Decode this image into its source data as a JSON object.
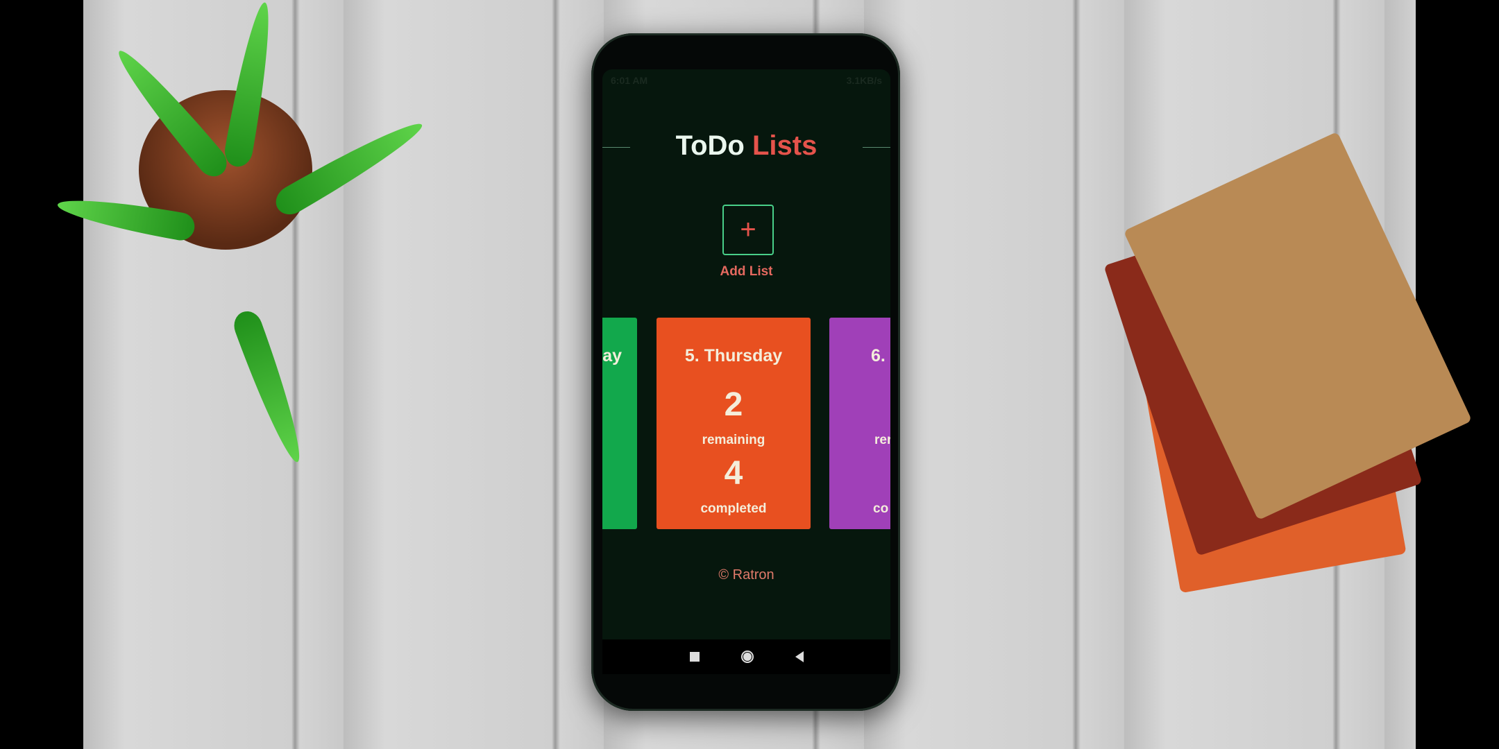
{
  "status_bar": {
    "time": "6:01 AM",
    "net_speed": "3.1KB/s"
  },
  "header": {
    "title_part1": "ToDo",
    "title_part2": "Lists"
  },
  "add_list": {
    "icon": "plus-icon",
    "symbol": "+",
    "label": "Add List"
  },
  "cards": [
    {
      "title": "ay",
      "color": "#12a84c"
    },
    {
      "title": "5. Thursday",
      "remaining": "2",
      "remaining_label": "remaining",
      "completed": "4",
      "completed_label": "completed",
      "color": "#e85020"
    },
    {
      "title": "6.",
      "remaining_label": "rer",
      "completed_label": "co",
      "color": "#a040b8"
    }
  ],
  "footer": {
    "copyright": "© Ratron"
  },
  "nav": {
    "recent": "recent-apps-icon",
    "home": "home-icon",
    "back": "back-icon"
  }
}
